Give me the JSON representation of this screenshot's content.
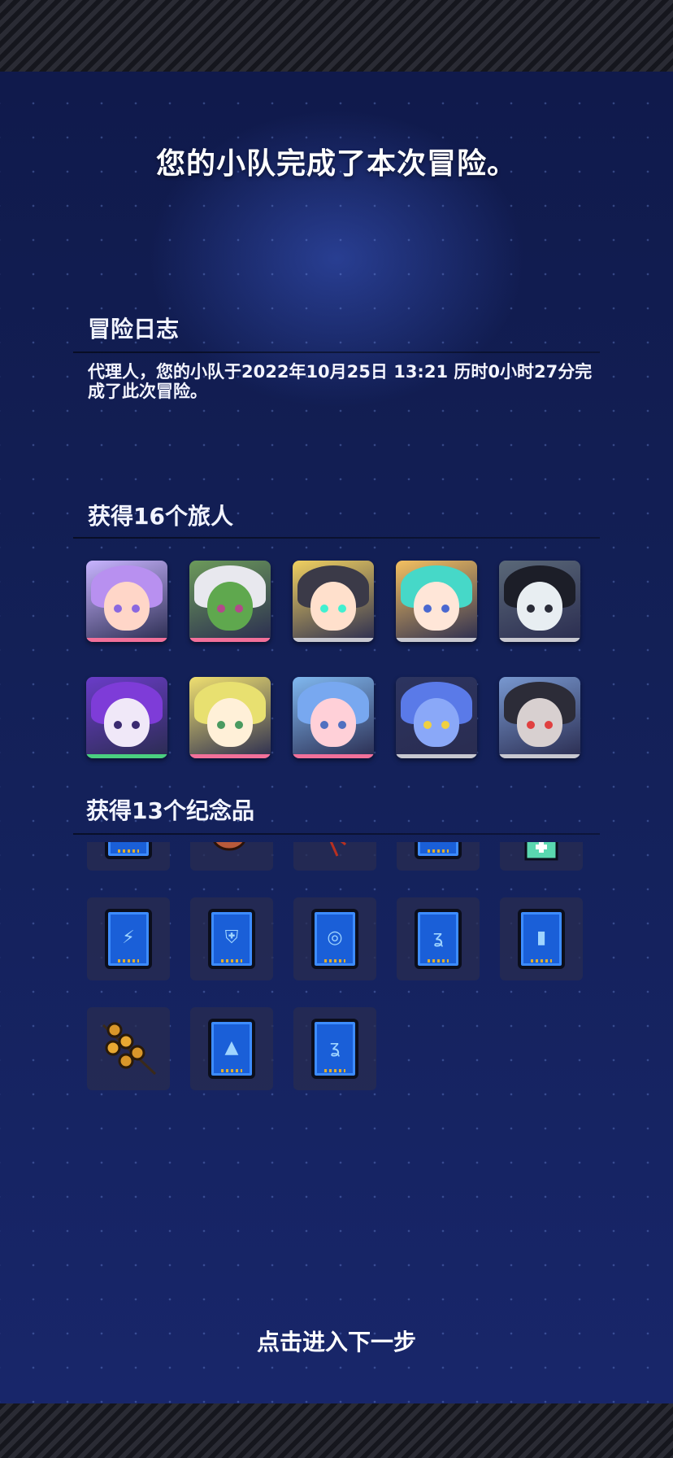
{
  "header": {
    "title": "您的小队完成了本次冒险。"
  },
  "log": {
    "heading": "冒险日志",
    "text": "代理人，您的小队于2022年10月25日 13:21 历时0小时27分完成了此次冒险。"
  },
  "travelers": {
    "heading": "获得16个旅人",
    "items": [
      {
        "icon": "traveler-portrait-1",
        "accent": "#f2709a",
        "bg": "#c8b4ff",
        "hair": "#b890f0",
        "skin": "#ffd6c8",
        "eye": "#8a68e0"
      },
      {
        "icon": "traveler-portrait-2",
        "accent": "#f2709a",
        "bg": "#6c9a5a",
        "hair": "#e8e8ee",
        "skin": "#5fa84e",
        "eye": "#b24a8a"
      },
      {
        "icon": "traveler-portrait-3",
        "accent": "#c8c8d0",
        "bg": "#f0d060",
        "hair": "#3b3a48",
        "skin": "#ffe0cc",
        "eye": "#40f0d0"
      },
      {
        "icon": "traveler-portrait-4",
        "accent": "#c8c8d0",
        "bg": "#f4c060",
        "hair": "#46d8c8",
        "skin": "#ffe6d8",
        "eye": "#4a68d0"
      },
      {
        "icon": "traveler-portrait-5",
        "accent": "#c8c8d0",
        "bg": "#5a6878",
        "hair": "#1c1e28",
        "skin": "#e8eef2",
        "eye": "#2a2c38"
      },
      {
        "icon": "traveler-portrait-6",
        "accent": "#4ad080",
        "bg": "#6a3cc8",
        "hair": "#7e3cd8",
        "skin": "#f0e8f8",
        "eye": "#3a2a70"
      },
      {
        "icon": "traveler-portrait-7",
        "accent": "#f2709a",
        "bg": "#f0e070",
        "hair": "#e8e070",
        "skin": "#fff0d8",
        "eye": "#4a9a60"
      },
      {
        "icon": "traveler-portrait-8",
        "accent": "#f2709a",
        "bg": "#80b8f0",
        "hair": "#78a8f0",
        "skin": "#ffd0d8",
        "eye": "#5070c0"
      },
      {
        "icon": "traveler-portrait-9",
        "accent": "#c8c8d0",
        "bg": "#2c3460",
        "hair": "#5a7ae8",
        "skin": "#8aa8f8",
        "eye": "#f0d040"
      },
      {
        "icon": "traveler-portrait-10",
        "accent": "#c8c8d0",
        "bg": "#7898d0",
        "hair": "#2c2c38",
        "skin": "#d8d0d0",
        "eye": "#e04040"
      }
    ]
  },
  "souvenirs": {
    "heading": "获得13个纪念品",
    "rows": [
      [
        {
          "icon": "data-card-icon",
          "glyph": "◆"
        },
        {
          "icon": "fish-souvenir-icon",
          "glyph": ""
        },
        {
          "icon": "antler-souvenir-icon",
          "glyph": ""
        },
        {
          "icon": "data-card-icon",
          "glyph": "◆"
        },
        {
          "icon": "medkit-souvenir-icon",
          "glyph": ""
        }
      ],
      [
        {
          "icon": "lightning-card-icon",
          "glyph": "⚡"
        },
        {
          "icon": "shield-card-icon",
          "glyph": "⛨"
        },
        {
          "icon": "eye-card-icon",
          "glyph": "◎"
        },
        {
          "icon": "ear-card-icon",
          "glyph": "ʓ"
        },
        {
          "icon": "battery-card-icon",
          "glyph": "▮"
        }
      ],
      [
        {
          "icon": "skewer-souvenir-icon",
          "glyph": ""
        },
        {
          "icon": "rocket-card-icon",
          "glyph": "▲"
        },
        {
          "icon": "ear-card-icon",
          "glyph": "ʓ"
        }
      ]
    ]
  },
  "footer": {
    "next_label": "点击进入下一步"
  },
  "colors": {
    "panel_top": "#101a4c",
    "panel_bottom": "#18266a",
    "card_blue": "#1a5fd8"
  }
}
